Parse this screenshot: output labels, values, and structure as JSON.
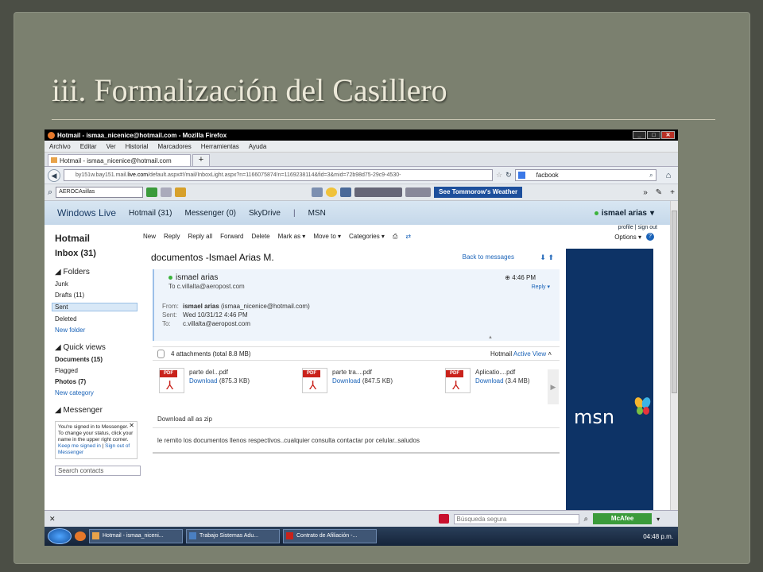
{
  "slide": {
    "title": "iii. Formalización del Casillero"
  },
  "window": {
    "title": "Hotmail - ismaa_nicenice@hotmail.com - Mozilla Firefox"
  },
  "menu": [
    "Archivo",
    "Editar",
    "Ver",
    "Historial",
    "Marcadores",
    "Herramientas",
    "Ayuda"
  ],
  "tab": {
    "label": "Hotmail - ismaa_nicenice@hotmail.com",
    "plus": "+"
  },
  "nav": {
    "url_prefix": "by151w.bay151.mail.",
    "url_domain": "live.com",
    "url_rest": "/default.aspx#!/mail/InboxLight.aspx?n=1166075874!n=1169238114&fid=3&mid=72b98d75-29c9-4530-",
    "search_value": "facbook"
  },
  "toolbar2": {
    "select_value": "AEROCAsillas",
    "weather_button": "See Tommorow's Weather"
  },
  "live": {
    "brand": "Windows Live",
    "links": [
      "Hotmail (31)",
      "Messenger (0)",
      "SkyDrive",
      "MSN"
    ],
    "user": "ismael arias",
    "profile": "profile",
    "signout": "sign out"
  },
  "leftnav": {
    "hotmail": "Hotmail",
    "inbox": "Inbox (31)",
    "folders_header": "Folders",
    "folders": [
      "Junk",
      "Drafts (11)",
      "Sent",
      "Deleted"
    ],
    "new_folder": "New folder",
    "quick_views_header": "Quick views",
    "documents": "Documents  (15)",
    "flagged": "Flagged",
    "photos": "Photos  (7)",
    "new_category": "New category",
    "messenger_header": "Messenger",
    "messenger_text": "You're signed in to Messenger. To change your status, click your name in the upper right corner.",
    "keep_signed": "Keep me signed in",
    "sign_out_msgr": "Sign out of Messenger",
    "search_contacts": "Search contacts"
  },
  "actions": [
    "New",
    "Reply",
    "Reply all",
    "Forward",
    "Delete",
    "Mark as ▾",
    "Move to ▾",
    "Categories ▾"
  ],
  "options": "Options ▾",
  "message": {
    "subject": "documentos -Ismael Arias M.",
    "back": "Back to messages",
    "sender": "ismael arias",
    "to_line": "To c.villalta@aeropost.com",
    "time": "4:46 PM",
    "reply": "Reply",
    "from_label": "From:",
    "from_name": "ismael arias",
    "from_email": "(ismaa_nicenice@hotmail.com)",
    "sent_label": "Sent:",
    "sent_value": "Wed 10/31/12 4:46 PM",
    "to_label": "To:",
    "to_value": "c.villalta@aeropost.com",
    "attachments": "4 attachments (total 8.8 MB)",
    "hotmail_label": "Hotmail",
    "active_view": "Active View",
    "files": [
      {
        "name": "parte del...pdf",
        "download": "Download",
        "size": "(875.3 KB)"
      },
      {
        "name": "parte tra....pdf",
        "download": "Download",
        "size": "(847.5 KB)"
      },
      {
        "name": "Aplicatio....pdf",
        "download": "Download",
        "size": "(3.4 MB)"
      }
    ],
    "zip": "Download all as zip",
    "body": "le remito los documentos llenos respectivos..cualquier consulta contactar por celular..saludos"
  },
  "ad": {
    "brand": "msn"
  },
  "statusbar": {
    "search_placeholder": "Búsqueda segura",
    "mcafee": "McAfee"
  },
  "taskbar": {
    "items": [
      "Hotmail - ismaa_niceni...",
      "Trabajo Sistemas Adu...",
      "Contrato de Afiliación -..."
    ],
    "clock": "04:48 p.m."
  }
}
